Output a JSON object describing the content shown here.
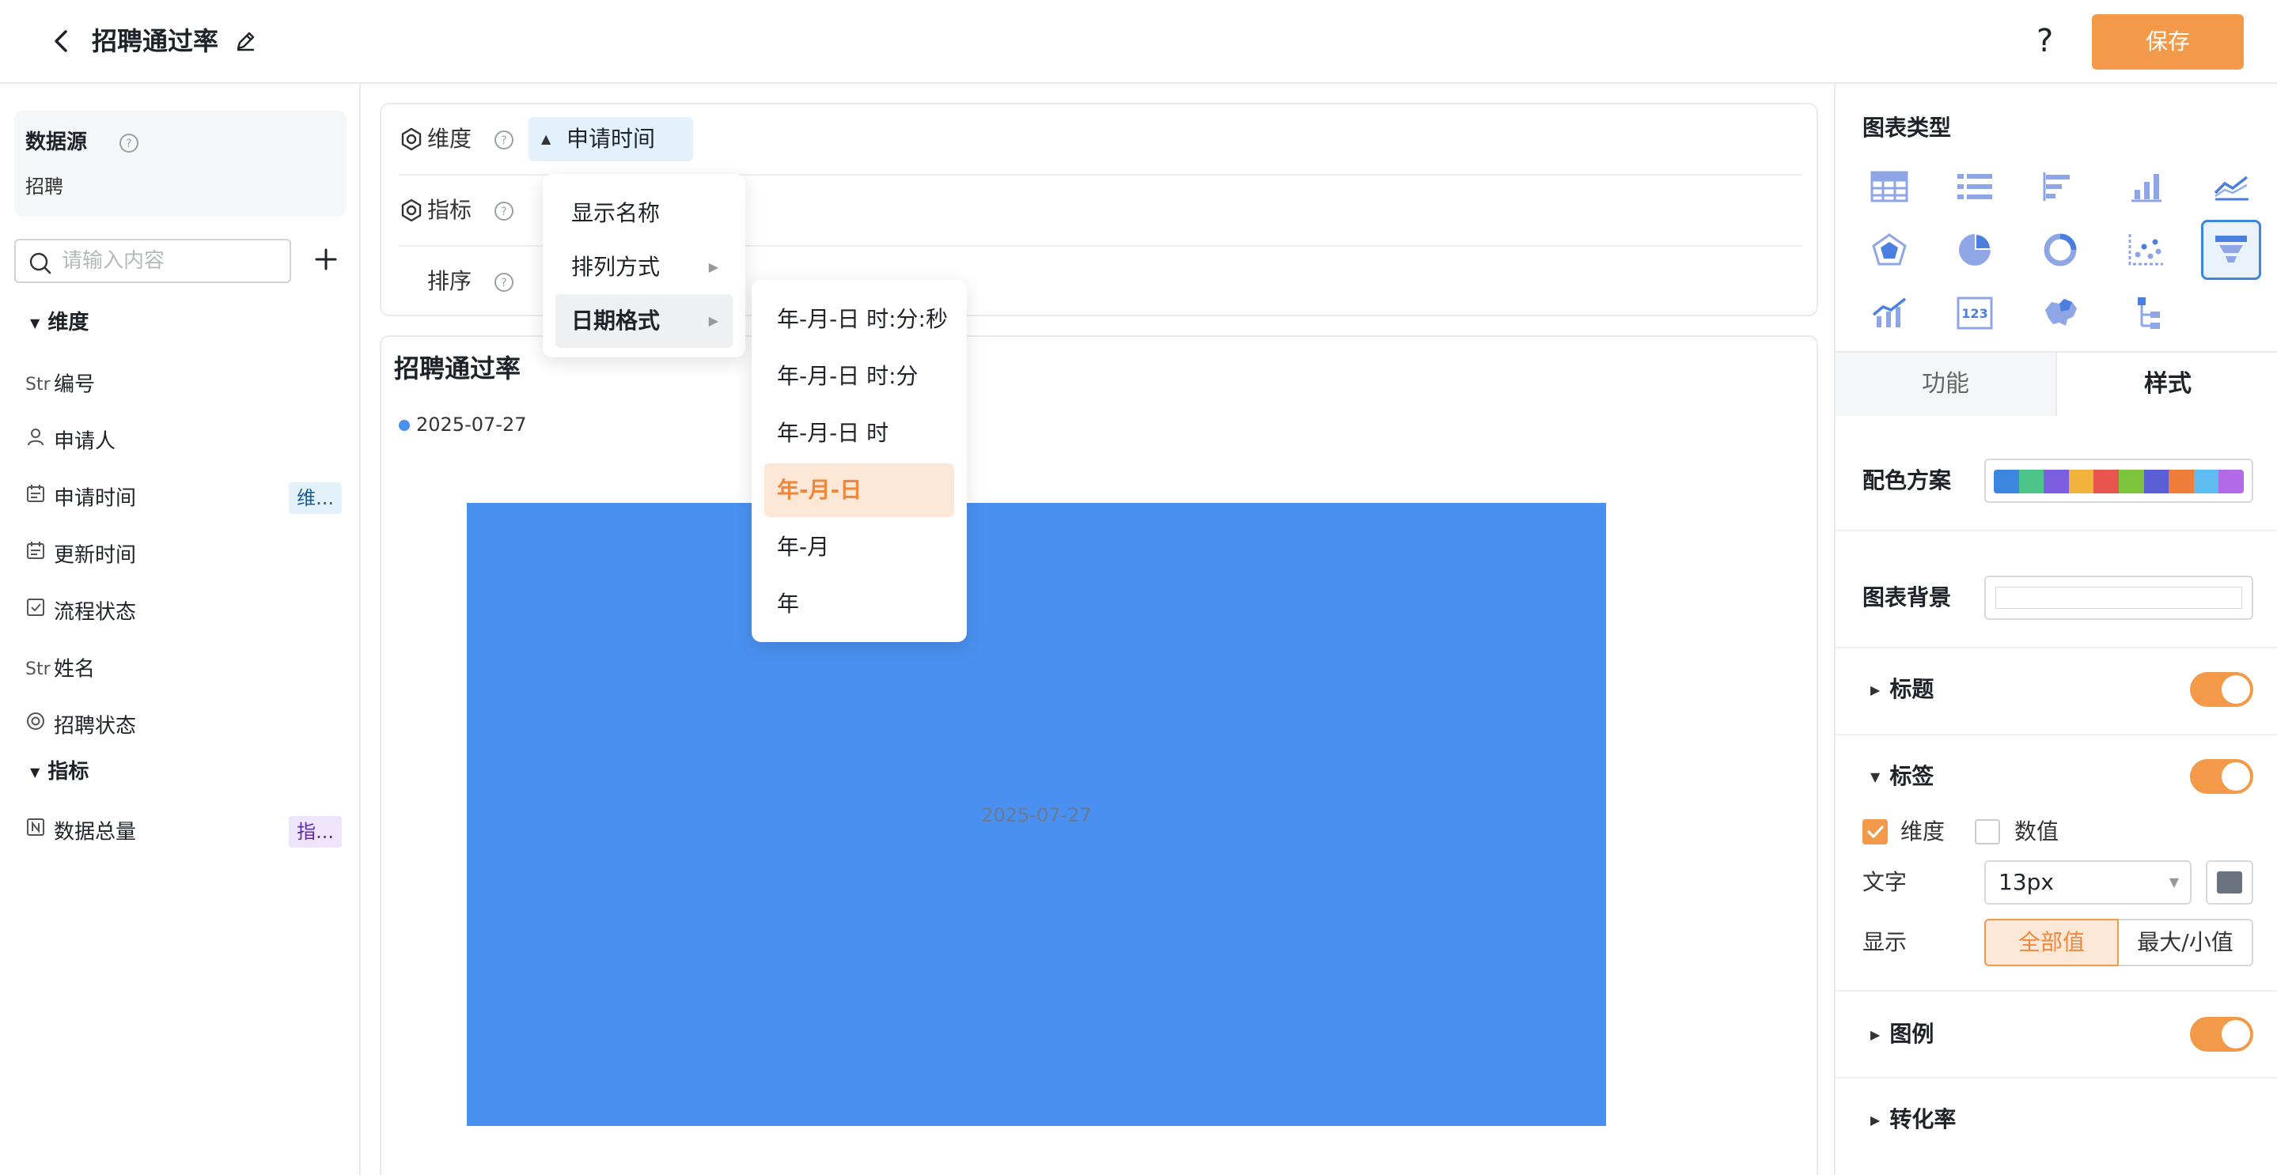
{
  "header": {
    "title": "招聘通过率",
    "help": "?",
    "save_label": "保存"
  },
  "left": {
    "datasource_title": "数据源",
    "datasource_value": "招聘",
    "search_placeholder": "请输入内容",
    "dim_group": "维度",
    "metric_group": "指标",
    "fields": [
      {
        "icon": "Str",
        "name": "编号"
      },
      {
        "icon": "person",
        "name": "申请人"
      },
      {
        "icon": "calendar",
        "name": "申请时间",
        "tag": "维..."
      },
      {
        "icon": "calendar",
        "name": "更新时间"
      },
      {
        "icon": "check",
        "name": "流程状态"
      },
      {
        "icon": "Str",
        "name": "姓名"
      },
      {
        "icon": "circle",
        "name": "招聘状态"
      }
    ],
    "metrics": [
      {
        "icon": "N",
        "name": "数据总量",
        "tag": "指..."
      }
    ]
  },
  "config": {
    "dim_label": "维度",
    "dim_chip": "申请时间",
    "metric_label": "指标",
    "sort_label": "排序"
  },
  "menu1": {
    "items": [
      "显示名称",
      "排列方式",
      "日期格式"
    ]
  },
  "menu2": {
    "items": [
      "年-月-日 时:分:秒",
      "年-月-日 时:分",
      "年-月-日 时",
      "年-月-日",
      "年-月",
      "年"
    ],
    "selected": "年-月-日"
  },
  "chart": {
    "title": "招聘通过率",
    "legend": "2025-07-27"
  },
  "chart_data": {
    "type": "funnel",
    "categories": [
      "2025-07-27"
    ],
    "values": [
      1
    ],
    "legend_position": "top-left",
    "color": "#4a90f0"
  },
  "right": {
    "chart_type_title": "图表类型",
    "tab_func": "功能",
    "tab_style": "样式",
    "palette_label": "配色方案",
    "palette": [
      "#3d86e0",
      "#4cc48a",
      "#7b5fe0",
      "#f2b33d",
      "#e8544e",
      "#7cc43b",
      "#5a5fd6",
      "#ef7d3a",
      "#5dbdf0",
      "#b26ae6"
    ],
    "bg_label": "图表背景",
    "title_sec": "标题",
    "label_sec": "标签",
    "cb_dim": "维度",
    "cb_value": "数值",
    "text_label": "文字",
    "font_size": "13px",
    "display_label": "显示",
    "seg_all": "全部值",
    "seg_max": "最大/小值",
    "legend_sec": "图例",
    "conv_sec": "转化率"
  },
  "colors": {
    "accent": "#f29a4a",
    "chart_blue": "#4a90f0"
  }
}
